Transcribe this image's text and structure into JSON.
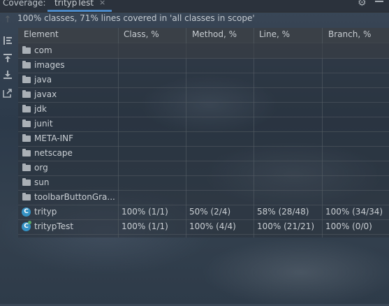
{
  "topbar": {
    "label": "Coverage:",
    "tab": "tritypTest",
    "close": "×",
    "gear": "⚙"
  },
  "summary": "100% classes, 71% lines covered in 'all classes in scope'",
  "columns": [
    "Element",
    "Class, %",
    "Method, %",
    "Line, %",
    "Branch, %"
  ],
  "rows": [
    {
      "name": "com",
      "type": "package"
    },
    {
      "name": "images",
      "type": "package"
    },
    {
      "name": "java",
      "type": "package"
    },
    {
      "name": "javax",
      "type": "package"
    },
    {
      "name": "jdk",
      "type": "package"
    },
    {
      "name": "junit",
      "type": "package"
    },
    {
      "name": "META-INF",
      "type": "package"
    },
    {
      "name": "netscape",
      "type": "package"
    },
    {
      "name": "org",
      "type": "package"
    },
    {
      "name": "sun",
      "type": "package"
    },
    {
      "name": "toolbarButtonGra...",
      "type": "package"
    },
    {
      "name": "trityp",
      "type": "class",
      "class_pct": "100% (1/1)",
      "method_pct": "50% (2/4)",
      "line_pct": "58% (28/48)",
      "branch_pct": "100% (34/34)"
    },
    {
      "name": "tritypTest",
      "type": "class",
      "class_pct": "100% (1/1)",
      "method_pct": "100% (4/4)",
      "line_pct": "100% (21/21)",
      "branch_pct": "100% (0/0)"
    }
  ],
  "colors": {
    "accent": "#4a88c7",
    "class_icon": "#3592c4",
    "test_badge": "#59a869"
  }
}
